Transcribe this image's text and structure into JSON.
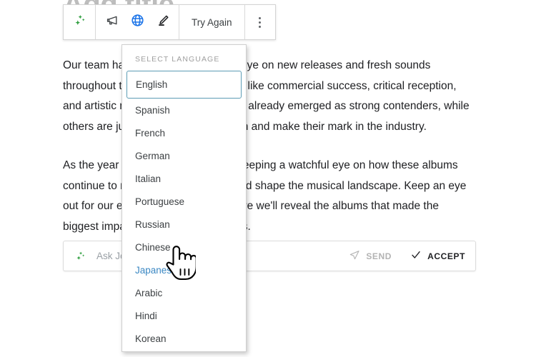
{
  "document": {
    "title_placeholder": "Add title",
    "paragraphs": [
      "Our team has been keeping a close eye on new releases and fresh sounds throughout the year, weighing factors like commercial success, critical reception, and artistic merit. Some albums have already emerged as strong contenders, while others are just starting to gain traction and make their mark in the industry.",
      "As the year draws to a close, we're keeping a watchful eye on how these albums continue to resonate with listeners and shape the musical landscape. Keep an eye out for our end-of-year roundup, where we'll reveal the albums that made the biggest impact on the charts and ears."
    ]
  },
  "toolbar": {
    "sparkle_icon": "sparkle-icon",
    "tone_icon": "megaphone-icon",
    "translate_icon": "globe-icon",
    "edit_icon": "pencil-icon",
    "try_again_label": "Try Again",
    "more_icon": "kebab-menu-icon",
    "accent_color": "#1a73e8",
    "sparkle_color": "#2e9e3e"
  },
  "language_menu": {
    "heading": "SELECT LANGUAGE",
    "selected": "English",
    "hovered": "Japanese",
    "selected_border_color": "#5c9cb5",
    "hover_text_color": "#3b88c3",
    "items": [
      {
        "label": "English"
      },
      {
        "label": "Spanish"
      },
      {
        "label": "French"
      },
      {
        "label": "German"
      },
      {
        "label": "Italian"
      },
      {
        "label": "Portuguese"
      },
      {
        "label": "Russian"
      },
      {
        "label": "Chinese"
      },
      {
        "label": "Japanese"
      },
      {
        "label": "Arabic"
      },
      {
        "label": "Hindi"
      },
      {
        "label": "Korean"
      }
    ]
  },
  "prompt_bar": {
    "sparkle_icon": "sparkle-icon",
    "input_value": "",
    "placeholder": "Ask Jetpack AI",
    "send_label": "SEND",
    "send_icon": "send-icon",
    "send_enabled": false,
    "accept_label": "ACCEPT",
    "accept_icon": "check-icon"
  },
  "cursor": {
    "type": "pointing-hand"
  }
}
